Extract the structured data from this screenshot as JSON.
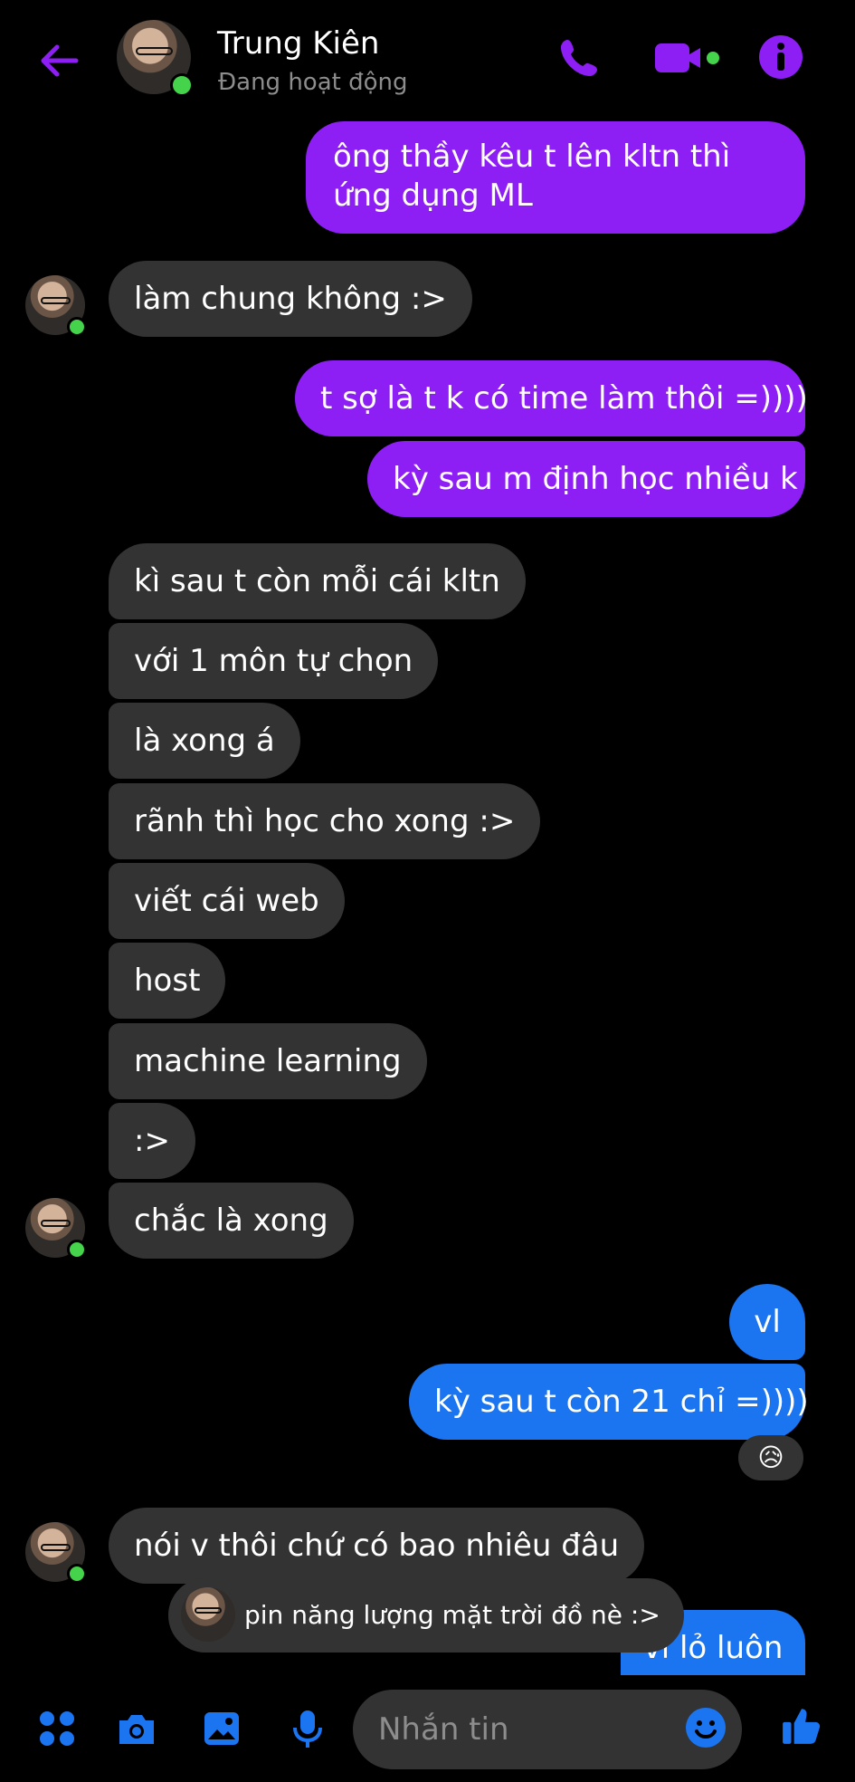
{
  "header": {
    "contact_name": "Trung Kiên",
    "status": "Đang hoạt động",
    "icons": [
      "back-arrow-icon",
      "phone-icon",
      "video-camera-icon",
      "info-icon"
    ],
    "accent": "#8d1ff4"
  },
  "messages": [
    {
      "side": "out",
      "text": "ông thầy kêu t lên kltn thì ứng dụng ML"
    },
    {
      "side": "in",
      "text": "làm chung không :>"
    },
    {
      "side": "out",
      "text": "t sợ là t k có time làm thôi =))))"
    },
    {
      "side": "out",
      "text": "kỳ sau m định học nhiều k"
    },
    {
      "side": "in",
      "text": "kì sau t còn mỗi cái kltn"
    },
    {
      "side": "in",
      "text": "với 1 môn tự chọn"
    },
    {
      "side": "in",
      "text": "là xong á"
    },
    {
      "side": "in",
      "text": "rãnh thì học cho xong :>"
    },
    {
      "side": "in",
      "text": "viết cái web"
    },
    {
      "side": "in",
      "text": "host"
    },
    {
      "side": "in",
      "text": "machine learning"
    },
    {
      "side": "in",
      "text": ":>"
    },
    {
      "side": "in",
      "text": "chắc là xong"
    },
    {
      "side": "out",
      "text": "vl"
    },
    {
      "side": "out",
      "text": "kỳ sau t còn 21 chỉ =))))"
    },
    {
      "side": "in",
      "text": "nói v thôi chứ có bao nhiêu đâu"
    },
    {
      "side": "out",
      "text": "vl lỏ luôn"
    }
  ],
  "reaction": "😥",
  "popup_text": "pin năng lượng mặt trời đồ nè :>",
  "composer": {
    "placeholder": "Nhắn tin",
    "icons": [
      "apps-icon",
      "camera-icon",
      "image-icon",
      "microphone-icon",
      "emoji-icon",
      "like-icon"
    ]
  },
  "colors": {
    "outgoing_purple": "#8d1ff4",
    "outgoing_blue": "#1b74f0",
    "incoming_gray": "#333333",
    "background": "#000000",
    "online_green": "#44d34b"
  }
}
